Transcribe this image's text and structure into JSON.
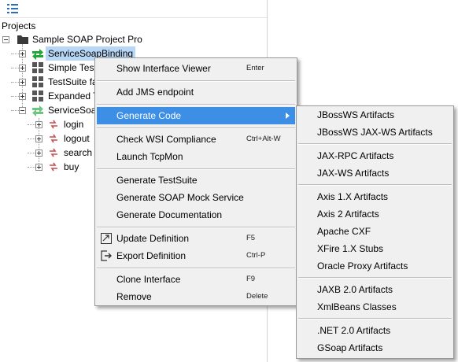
{
  "panel": {
    "title": "Projects"
  },
  "tree": {
    "project": "Sample SOAP Project Pro",
    "items": [
      {
        "label": "ServiceSoapBinding",
        "icon": "interface-icon",
        "selected": true
      },
      {
        "label": "Simple Test",
        "icon": "testsuite-icon"
      },
      {
        "label": "TestSuite fa",
        "icon": "testsuite-icon"
      },
      {
        "label": "Expanded T",
        "icon": "testsuite-icon"
      },
      {
        "label": "ServiceSoap",
        "icon": "interface-icon"
      }
    ],
    "operations": [
      "login",
      "logout",
      "search",
      "buy"
    ]
  },
  "context_menu": {
    "items": [
      {
        "label": "Show Interface Viewer",
        "shortcut": "Enter"
      },
      {
        "label": "Add JMS endpoint",
        "shortcut": ""
      },
      {
        "label": "Generate Code",
        "shortcut": "",
        "submenu": true,
        "highlighted": true
      },
      {
        "label": "Check WSI Compliance",
        "shortcut": "Ctrl+Alt-W"
      },
      {
        "label": "Launch TcpMon",
        "shortcut": ""
      },
      {
        "label": "Generate TestSuite",
        "shortcut": ""
      },
      {
        "label": "Generate SOAP Mock Service",
        "shortcut": ""
      },
      {
        "label": "Generate Documentation",
        "shortcut": ""
      },
      {
        "label": "Update Definition",
        "shortcut": "F5",
        "icon": "update-icon"
      },
      {
        "label": "Export Definition",
        "shortcut": "Ctrl-P",
        "icon": "export-icon"
      },
      {
        "label": "Clone Interface",
        "shortcut": "F9"
      },
      {
        "label": "Remove",
        "shortcut": "Delete"
      }
    ]
  },
  "submenu": {
    "items": [
      "JBossWS Artifacts",
      "JBossWS JAX-WS Artifacts",
      "JAX-RPC Artifacts",
      "JAX-WS Artifacts",
      "Axis 1.X Artifacts",
      "Axis 2 Artifacts",
      "Apache CXF",
      "XFire 1.X Stubs",
      "Oracle Proxy Artifacts",
      "JAXB 2.0 Artifacts",
      "XmlBeans Classes",
      ".NET 2.0 Artifacts",
      "GSoap Artifacts"
    ]
  },
  "colors": {
    "highlight": "#3d8ee5",
    "selection": "#b8d6f5",
    "menu_bg": "#f0f0f0",
    "green_arrow": "#1fa83a",
    "red_arrow": "#c84b4b"
  }
}
